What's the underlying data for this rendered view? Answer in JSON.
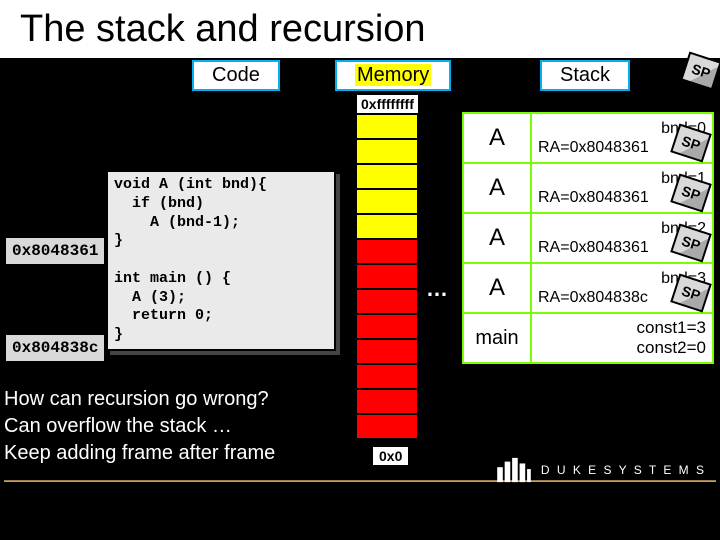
{
  "title": "The stack and recursion",
  "sections": {
    "code": "Code",
    "memory": "Memory",
    "stack": "Stack"
  },
  "mem": {
    "top": "0xffffffff",
    "bottom": "0x0"
  },
  "code_lines": "void A (int bnd){\n  if (bnd)\n    A (bnd-1);\n}\n\nint main () {\n  A (3);\n  return 0;\n}",
  "addrs": {
    "a": "0x8048361",
    "m": "0x804838c"
  },
  "sp": "SP",
  "frames": [
    {
      "name": "A",
      "l1": "bnd=0",
      "l2": "RA=0x8048361"
    },
    {
      "name": "A",
      "l1": "bnd=1",
      "l2": "RA=0x8048361"
    },
    {
      "name": "A",
      "l1": "bnd=2",
      "l2": "RA=0x8048361"
    },
    {
      "name": "A",
      "l1": "bnd=3",
      "l2": "RA=0x804838c"
    },
    {
      "name": "main",
      "l1": "const1=3",
      "l2": "const2=0"
    }
  ],
  "ellipsis": "…",
  "question": {
    "l1": "How can recursion go wrong?",
    "l2": "Can overflow the stack …",
    "l3": "Keep adding frame after frame"
  },
  "footer": "D U K E   S Y S T E M S"
}
